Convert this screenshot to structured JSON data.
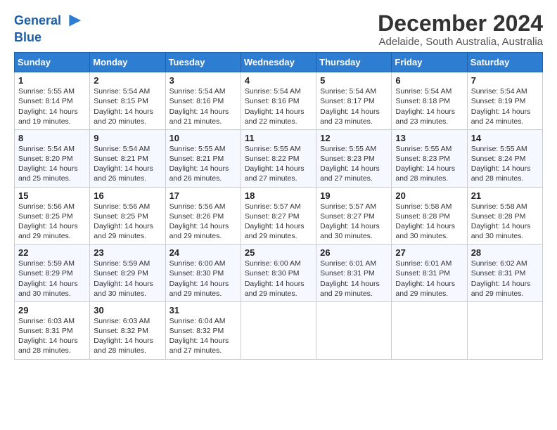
{
  "logo": {
    "line1": "General",
    "line2": "Blue"
  },
  "title": "December 2024",
  "subtitle": "Adelaide, South Australia, Australia",
  "weekdays": [
    "Sunday",
    "Monday",
    "Tuesday",
    "Wednesday",
    "Thursday",
    "Friday",
    "Saturday"
  ],
  "weeks": [
    [
      {
        "day": "1",
        "sunrise": "5:55 AM",
        "sunset": "8:14 PM",
        "daylight": "14 hours and 19 minutes."
      },
      {
        "day": "2",
        "sunrise": "5:54 AM",
        "sunset": "8:15 PM",
        "daylight": "14 hours and 20 minutes."
      },
      {
        "day": "3",
        "sunrise": "5:54 AM",
        "sunset": "8:16 PM",
        "daylight": "14 hours and 21 minutes."
      },
      {
        "day": "4",
        "sunrise": "5:54 AM",
        "sunset": "8:16 PM",
        "daylight": "14 hours and 22 minutes."
      },
      {
        "day": "5",
        "sunrise": "5:54 AM",
        "sunset": "8:17 PM",
        "daylight": "14 hours and 23 minutes."
      },
      {
        "day": "6",
        "sunrise": "5:54 AM",
        "sunset": "8:18 PM",
        "daylight": "14 hours and 23 minutes."
      },
      {
        "day": "7",
        "sunrise": "5:54 AM",
        "sunset": "8:19 PM",
        "daylight": "14 hours and 24 minutes."
      }
    ],
    [
      {
        "day": "8",
        "sunrise": "5:54 AM",
        "sunset": "8:20 PM",
        "daylight": "14 hours and 25 minutes."
      },
      {
        "day": "9",
        "sunrise": "5:54 AM",
        "sunset": "8:21 PM",
        "daylight": "14 hours and 26 minutes."
      },
      {
        "day": "10",
        "sunrise": "5:55 AM",
        "sunset": "8:21 PM",
        "daylight": "14 hours and 26 minutes."
      },
      {
        "day": "11",
        "sunrise": "5:55 AM",
        "sunset": "8:22 PM",
        "daylight": "14 hours and 27 minutes."
      },
      {
        "day": "12",
        "sunrise": "5:55 AM",
        "sunset": "8:23 PM",
        "daylight": "14 hours and 27 minutes."
      },
      {
        "day": "13",
        "sunrise": "5:55 AM",
        "sunset": "8:23 PM",
        "daylight": "14 hours and 28 minutes."
      },
      {
        "day": "14",
        "sunrise": "5:55 AM",
        "sunset": "8:24 PM",
        "daylight": "14 hours and 28 minutes."
      }
    ],
    [
      {
        "day": "15",
        "sunrise": "5:56 AM",
        "sunset": "8:25 PM",
        "daylight": "14 hours and 29 minutes."
      },
      {
        "day": "16",
        "sunrise": "5:56 AM",
        "sunset": "8:25 PM",
        "daylight": "14 hours and 29 minutes."
      },
      {
        "day": "17",
        "sunrise": "5:56 AM",
        "sunset": "8:26 PM",
        "daylight": "14 hours and 29 minutes."
      },
      {
        "day": "18",
        "sunrise": "5:57 AM",
        "sunset": "8:27 PM",
        "daylight": "14 hours and 29 minutes."
      },
      {
        "day": "19",
        "sunrise": "5:57 AM",
        "sunset": "8:27 PM",
        "daylight": "14 hours and 30 minutes."
      },
      {
        "day": "20",
        "sunrise": "5:58 AM",
        "sunset": "8:28 PM",
        "daylight": "14 hours and 30 minutes."
      },
      {
        "day": "21",
        "sunrise": "5:58 AM",
        "sunset": "8:28 PM",
        "daylight": "14 hours and 30 minutes."
      }
    ],
    [
      {
        "day": "22",
        "sunrise": "5:59 AM",
        "sunset": "8:29 PM",
        "daylight": "14 hours and 30 minutes."
      },
      {
        "day": "23",
        "sunrise": "5:59 AM",
        "sunset": "8:29 PM",
        "daylight": "14 hours and 30 minutes."
      },
      {
        "day": "24",
        "sunrise": "6:00 AM",
        "sunset": "8:30 PM",
        "daylight": "14 hours and 29 minutes."
      },
      {
        "day": "25",
        "sunrise": "6:00 AM",
        "sunset": "8:30 PM",
        "daylight": "14 hours and 29 minutes."
      },
      {
        "day": "26",
        "sunrise": "6:01 AM",
        "sunset": "8:31 PM",
        "daylight": "14 hours and 29 minutes."
      },
      {
        "day": "27",
        "sunrise": "6:01 AM",
        "sunset": "8:31 PM",
        "daylight": "14 hours and 29 minutes."
      },
      {
        "day": "28",
        "sunrise": "6:02 AM",
        "sunset": "8:31 PM",
        "daylight": "14 hours and 29 minutes."
      }
    ],
    [
      {
        "day": "29",
        "sunrise": "6:03 AM",
        "sunset": "8:31 PM",
        "daylight": "14 hours and 28 minutes."
      },
      {
        "day": "30",
        "sunrise": "6:03 AM",
        "sunset": "8:32 PM",
        "daylight": "14 hours and 28 minutes."
      },
      {
        "day": "31",
        "sunrise": "6:04 AM",
        "sunset": "8:32 PM",
        "daylight": "14 hours and 27 minutes."
      },
      null,
      null,
      null,
      null
    ]
  ],
  "labels": {
    "sunrise": "Sunrise:",
    "sunset": "Sunset:",
    "daylight": "Daylight:"
  }
}
